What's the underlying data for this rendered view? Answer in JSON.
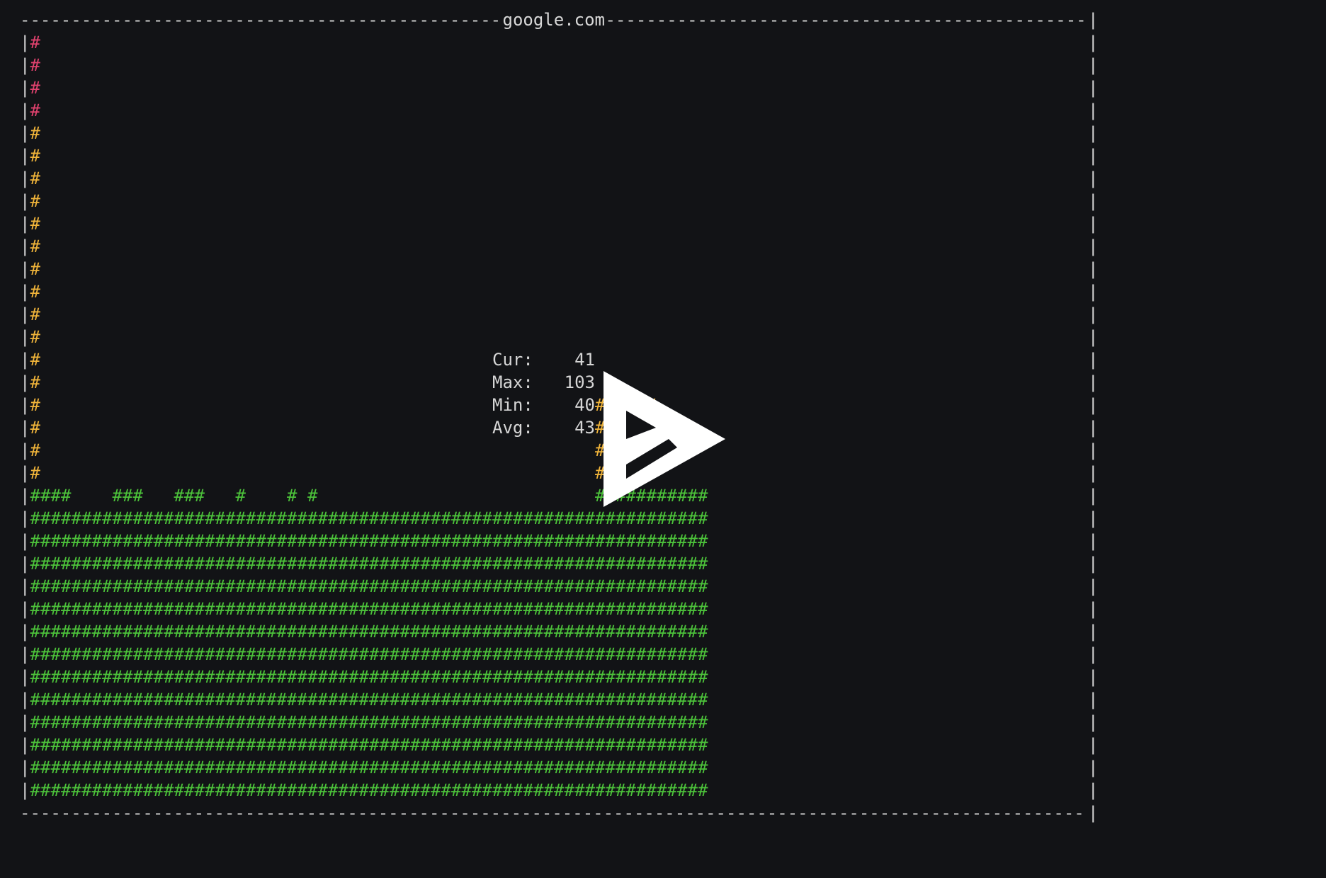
{
  "window": {
    "title": "google.com"
  },
  "stats": [
    {
      "label": "Cur:",
      "value": "41"
    },
    {
      "label": "Max:",
      "value": "103"
    },
    {
      "label": "Min:",
      "value": "40"
    },
    {
      "label": "Avg:",
      "value": "43"
    }
  ],
  "symbols": {
    "bar_char": "#",
    "border_vertical": "|",
    "border_dash": "-"
  },
  "chart_data": {
    "type": "bar",
    "title": "google.com",
    "xlabel": "",
    "ylabel": "",
    "ylim": [
      0,
      103
    ],
    "values": [
      103,
      41,
      41,
      41,
      40,
      40,
      40,
      40,
      41,
      41,
      41,
      40,
      40,
      40,
      41,
      41,
      41,
      40,
      40,
      40,
      41,
      40,
      40,
      40,
      40,
      41,
      40,
      41,
      40,
      40,
      40,
      40,
      40,
      40,
      40,
      40,
      40,
      40,
      40,
      40,
      40,
      40,
      40,
      40,
      40,
      40,
      40,
      40,
      40,
      40,
      40,
      40,
      40,
      40,
      40,
      55,
      55,
      55,
      55,
      55,
      55,
      41,
      41,
      41,
      41,
      41
    ],
    "summary": {
      "cur": 41,
      "max": 103,
      "min": 40,
      "avg": 43
    },
    "colors": {
      "high": "#e0426e",
      "mid": "#f0b43a",
      "low": "#4cc23a",
      "border": "#cfcfcf",
      "background": "#121316"
    }
  },
  "overlay": {
    "icon": "play-icon"
  }
}
